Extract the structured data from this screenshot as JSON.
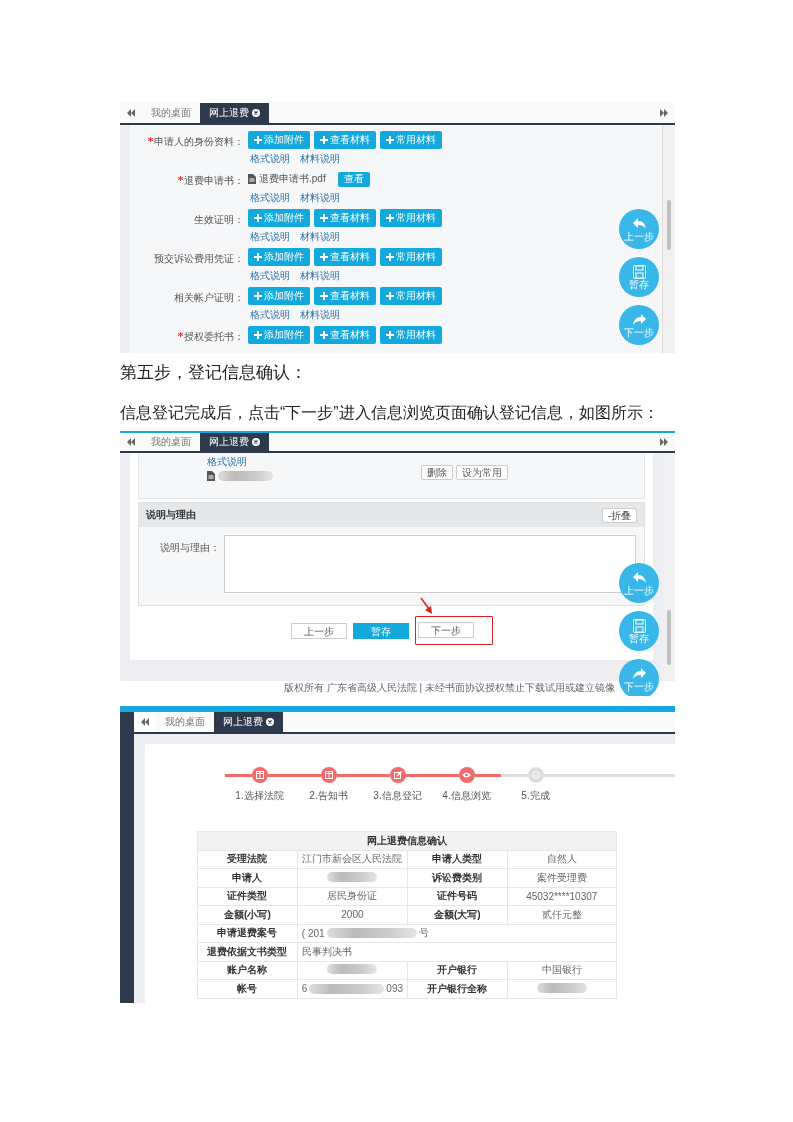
{
  "screenshot_1": {
    "tabs": [
      {
        "label": "我的桌面",
        "selected": false
      },
      {
        "label": "网上退费",
        "selected": true
      }
    ],
    "rows": [
      {
        "label": "申请人的身份资料：",
        "required": true,
        "kind": "upload",
        "buttons": [
          "添加附件",
          "查看材料",
          "常用材料"
        ],
        "links": [
          "格式说明",
          "材料说明"
        ]
      },
      {
        "label": "退费申请书：",
        "required": true,
        "kind": "file",
        "file": "退费申请书.pdf",
        "view_button": "查看",
        "links": [
          "格式说明",
          "材料说明"
        ]
      },
      {
        "label": "生效证明：",
        "required": false,
        "kind": "upload",
        "buttons": [
          "添加附件",
          "查看材料",
          "常用材料"
        ],
        "links": [
          "格式说明",
          "材料说明"
        ]
      },
      {
        "label": "预交诉讼费用凭证：",
        "required": false,
        "kind": "upload",
        "buttons": [
          "添加附件",
          "查看材料",
          "常用材料"
        ],
        "links": [
          "格式说明",
          "材料说明"
        ]
      },
      {
        "label": "相关帐户证明：",
        "required": false,
        "kind": "upload",
        "buttons": [
          "添加附件",
          "查看材料",
          "常用材料"
        ],
        "links": [
          "格式说明",
          "材料说明"
        ]
      },
      {
        "label": "授权委托书：",
        "required": true,
        "kind": "upload",
        "buttons": [
          "添加附件",
          "查看材料",
          "常用材料"
        ]
      }
    ],
    "float_buttons": [
      {
        "label": "上一步"
      },
      {
        "label": "暂存"
      },
      {
        "label": "下一步"
      }
    ]
  },
  "heading": "第五步，登记信息确认：",
  "paragraph": "信息登记完成后，点击“下一步”进入信息浏览页面确认登记信息，如图所示：",
  "screenshot_2": {
    "tabs": [
      {
        "label": "我的桌面",
        "selected": false
      },
      {
        "label": "网上退费",
        "selected": true
      }
    ],
    "link": "格式说明",
    "file_buttons": [
      "删除",
      "设为常用"
    ],
    "panel": {
      "title": "说明与理由",
      "collapse_button": "-折叠",
      "field_label": "说明与理由："
    },
    "actions": [
      {
        "label": "上一步",
        "kind": "default",
        "highlighted": false
      },
      {
        "label": "暂存",
        "kind": "primary",
        "highlighted": false
      },
      {
        "label": "下一步",
        "kind": "default",
        "highlighted": true
      }
    ],
    "float_buttons": [
      {
        "label": "上一步"
      },
      {
        "label": "暂存"
      },
      {
        "label": "下一步"
      }
    ],
    "footer": "版权所有 广东省高级人民法院 | 未经书面协议授权禁止下载试用或建立镜像"
  },
  "screenshot_3": {
    "tabs": [
      {
        "label": "我的桌面",
        "selected": false
      },
      {
        "label": "网上退费",
        "selected": true
      }
    ],
    "steps": [
      {
        "label": "1.选择法院",
        "done": true
      },
      {
        "label": "2.告知书",
        "done": true
      },
      {
        "label": "3.信息登记",
        "done": true
      },
      {
        "label": "4.信息浏览",
        "done": true
      },
      {
        "label": "5.完成",
        "done": false
      }
    ],
    "table": {
      "title": "网上退费信息确认",
      "rows": [
        {
          "label": "受理法院",
          "value": {
            "kind": "text",
            "text": "江门市新会区人民法院"
          },
          "label_2": "申请人类型",
          "value_2": {
            "kind": "text",
            "text": "自然人"
          }
        },
        {
          "label": "申请人",
          "value": {
            "kind": "blurred"
          },
          "label_2": "诉讼费类别",
          "value_2": {
            "kind": "text",
            "text": "案件受理费"
          }
        },
        {
          "label": "证件类型",
          "value": {
            "kind": "text",
            "text": "居民身份证"
          },
          "label_2": "证件号码",
          "value_2": {
            "kind": "text",
            "text": "45032****10307"
          }
        },
        {
          "label": "金额(小写)",
          "value": {
            "kind": "text",
            "text": "2000"
          },
          "label_2": "金额(大写)",
          "value_2": {
            "kind": "text",
            "text": "贰仟元整"
          }
        },
        {
          "label": "申请退费案号",
          "value": {
            "kind": "partial",
            "start": "( 201",
            "end": "号"
          }
        },
        {
          "label": "退费依据文书类型",
          "value": {
            "kind": "text",
            "text": "民事判决书"
          }
        },
        {
          "label": "账户名称",
          "value": {
            "kind": "blurred"
          },
          "label_2": "开户银行",
          "value_2": {
            "kind": "text",
            "text": "中国银行"
          }
        },
        {
          "label": "帐号",
          "value": {
            "kind": "partial",
            "start": "6",
            "end": "093"
          },
          "label_2": "开户银行全称",
          "value_2": {
            "kind": "blurred"
          }
        }
      ]
    }
  }
}
